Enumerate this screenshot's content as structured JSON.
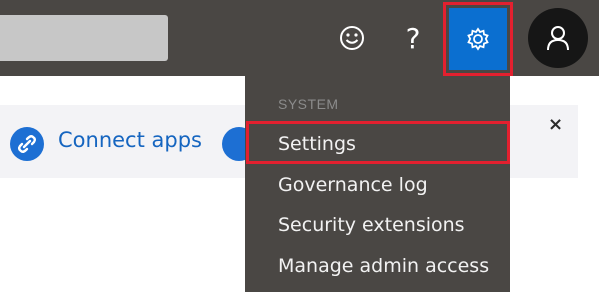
{
  "header": {
    "icons": [
      "smiley-icon",
      "help-icon",
      "gear-icon",
      "user-icon"
    ],
    "help_label": "?"
  },
  "banner": {
    "connect_label": "Connect apps",
    "close_label": "×"
  },
  "menu": {
    "section_label": "SYSTEM",
    "items": [
      {
        "label": "Settings"
      },
      {
        "label": "Governance log"
      },
      {
        "label": "Security extensions"
      },
      {
        "label": "Manage admin access"
      }
    ]
  },
  "colors": {
    "topbar": "#4a4744",
    "accent_blue": "#0b6fd0",
    "highlight_red": "#e3202f",
    "link_blue": "#1565c0"
  }
}
